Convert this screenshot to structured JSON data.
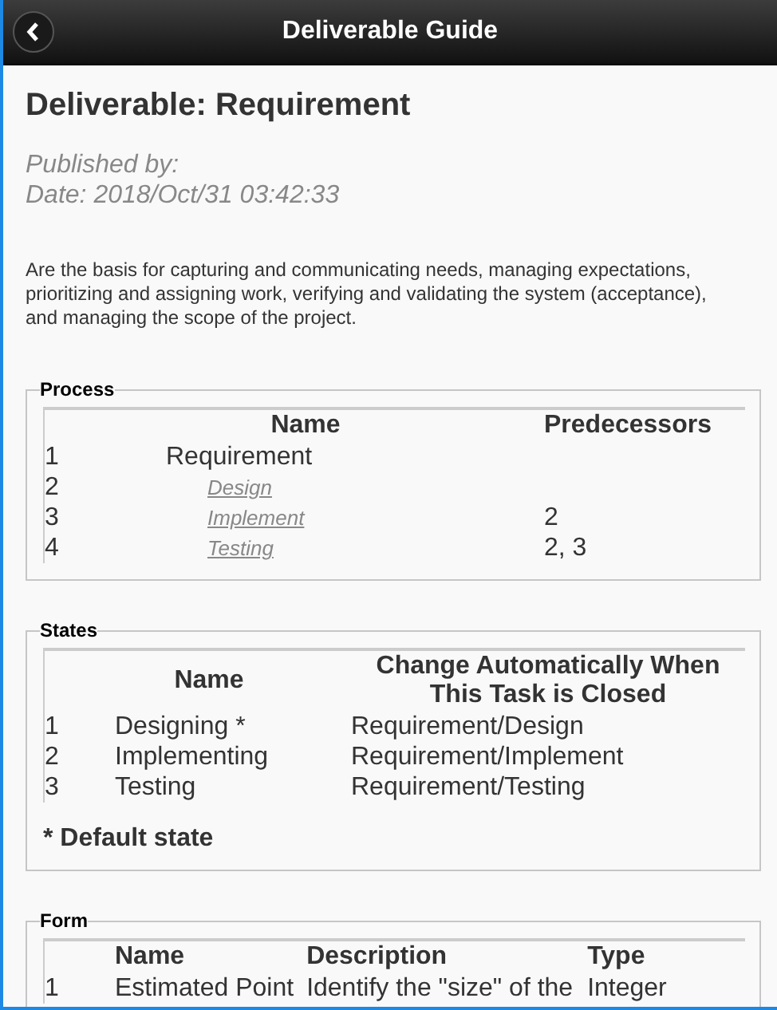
{
  "header": {
    "title": "Deliverable Guide"
  },
  "title": "Deliverable: Requirement",
  "published_by": "Published by:",
  "date": "Date: 2018/Oct/31 03:42:33",
  "description": "Are the basis for capturing and communicating needs, managing expectations, prioritizing and assigning work, verifying and validating the system (acceptance), and managing the scope of the project.",
  "process": {
    "legend": "Process",
    "columns": [
      "Name",
      "Predecessors"
    ],
    "rows": [
      {
        "number": "1",
        "name": "Requirement",
        "kind": "text",
        "children": [
          {
            "number": "2",
            "name": "Design",
            "kind": "link"
          },
          {
            "number": "3",
            "name": "Implement",
            "kind": "link",
            "predecessors": "2"
          },
          {
            "number": "4",
            "name": "Testing",
            "kind": "link",
            "predecessors": "2, 3"
          }
        ]
      }
    ]
  },
  "states": {
    "legend": "States",
    "columns": [
      "Name",
      "Change Automatically When This Task is Closed"
    ],
    "rows": [
      {
        "number": "1",
        "name": "Designing *",
        "change": "Requirement/Design"
      },
      {
        "number": "2",
        "name": "Implementing",
        "change": "Requirement/Implement"
      },
      {
        "number": "3",
        "name": "Testing",
        "change": "Requirement/Testing"
      }
    ],
    "note": "* Default state"
  },
  "form": {
    "legend": "Form",
    "columns": [
      "Name",
      "Description",
      "Type"
    ],
    "rows": [
      {
        "number": "1",
        "name": "Estimated Point",
        "description": "Identify the \"size\" of the",
        "type": "Integer"
      }
    ]
  }
}
